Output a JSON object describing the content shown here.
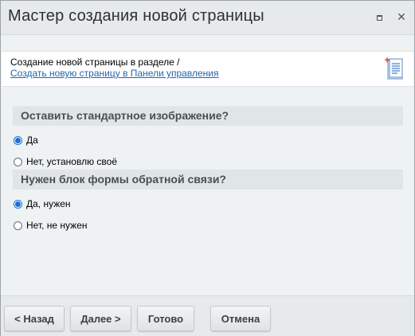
{
  "window": {
    "title": "Мастер создания новой страницы",
    "maximize_icon": "maximize-icon",
    "close_icon": "close-icon",
    "close_glyph": "✕"
  },
  "header": {
    "line": "Создание новой страницы в разделе /",
    "link": "Создать новую страницу в Панели управления",
    "icon": "new-page-icon"
  },
  "sections": [
    {
      "title": "Оставить стандартное изображение?",
      "options": [
        {
          "label": "Да",
          "checked": true
        },
        {
          "label": "Нет, установлю своё",
          "checked": false
        }
      ]
    },
    {
      "title": "Нужен блок формы обратной связи?",
      "options": [
        {
          "label": "Да, нужен",
          "checked": true
        },
        {
          "label": "Нет, не нужен",
          "checked": false
        }
      ]
    }
  ],
  "buttons": {
    "back": "< Назад",
    "next": "Далее >",
    "done": "Готово",
    "cancel": "Отмена"
  },
  "colors": {
    "accent": "#1f6fd1",
    "link": "#2067b0",
    "section_bg": "#e0e6e8"
  }
}
